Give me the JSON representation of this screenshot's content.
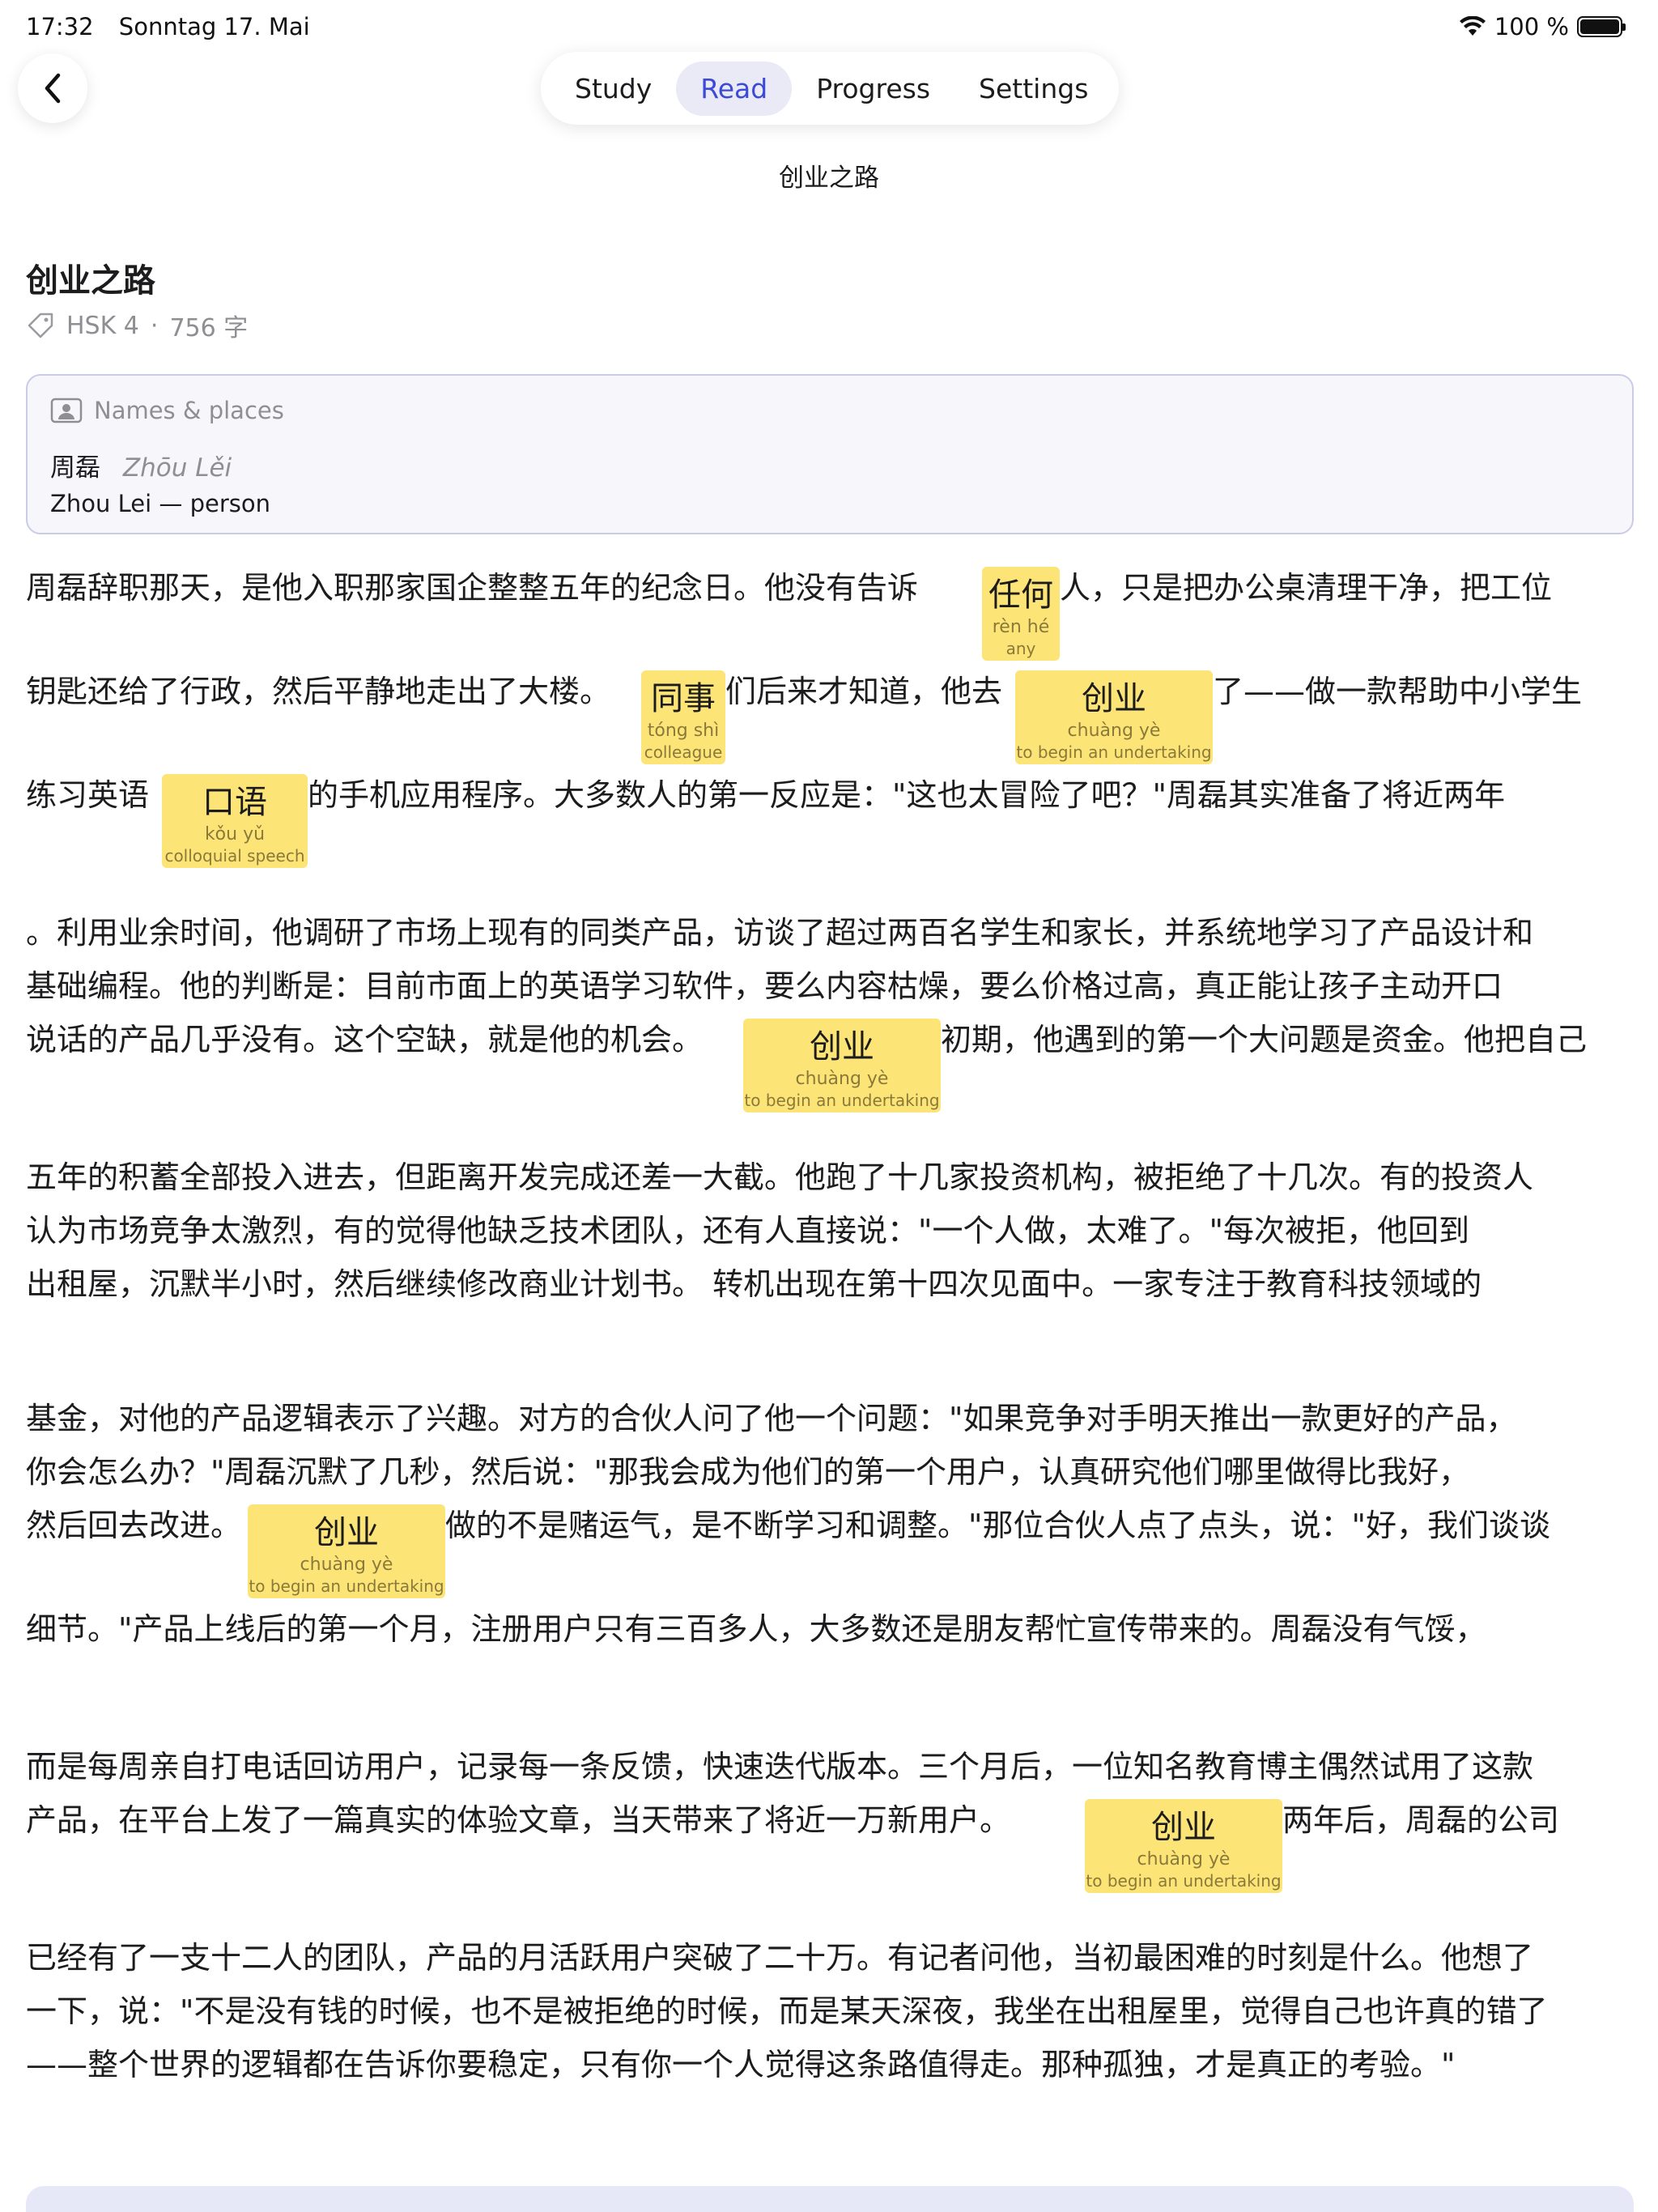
{
  "status": {
    "time": "17:32",
    "date": "Sonntag 17. Mai",
    "battery": "100 %",
    "battery_level": 1.0
  },
  "tabs": [
    {
      "label": "Study"
    },
    {
      "label": "Read",
      "active": true
    },
    {
      "label": "Progress"
    },
    {
      "label": "Settings"
    }
  ],
  "nav_title": "创业之路",
  "doc": {
    "title": "创业之路",
    "level": "HSK 4",
    "separator": "·",
    "count": "756 字"
  },
  "names": {
    "header": "Names & places",
    "items": [
      {
        "hanzi": "周磊",
        "pinyin": "Zhōu Lěi",
        "gloss": "Zhou Lei — person"
      }
    ]
  },
  "lines": [
    "周磊辞职那天，是他入职那家国企整整五年的纪念日。他没有告诉",
    "人，只是把办公桌清理干净，把工位",
    "钥匙还给了行政，然后平静地走出了大楼。",
    "们后来才知道，他去",
    "了——做一款帮助中小学生",
    "练习英语",
    "的手机应用程序。大多数人的第一反应是：\"这也太冒险了吧？\"周磊其实准备了将近两年",
    "。利用业余时间，他调研了市场上现有的同类产品，访谈了超过两百名学生和家长，并系统地学习了产品设计和",
    "基础编程。他的判断是：目前市面上的英语学习软件，要么内容枯燥，要么价格过高，真正能让孩子主动开口",
    "说话的产品几乎没有。这个空缺，就是他的机会。",
    "初期，他遇到的第一个大问题是资金。他把自己",
    "五年的积蓄全部投入进去，但距离开发完成还差一大截。他跑了十几家投资机构，被拒绝了十几次。有的投资人",
    "认为市场竞争太激烈，有的觉得他缺乏技术团队，还有人直接说：\"一个人做，太难了。\"每次被拒，他回到",
    "出租屋，沉默半小时，然后继续修改商业计划书。 转机出现在第十四次见面中。一家专注于教育科技领域的",
    "基金，对他的产品逻辑表示了兴趣。对方的合伙人问了他一个问题：\"如果竞争对手明天推出一款更好的产品，",
    "你会怎么办？\"周磊沉默了几秒，然后说：\"那我会成为他们的第一个用户，认真研究他们哪里做得比我好，",
    "然后回去改进。",
    "做的不是赌运气，是不断学习和调整。\"那位合伙人点了点头，说：\"好，我们谈谈",
    "细节。\"产品上线后的第一个月，注册用户只有三百多人，大多数还是朋友帮忙宣传带来的。周磊没有气馁，",
    "而是每周亲自打电话回访用户，记录每一条反馈，快速迭代版本。三个月后，一位知名教育博主偶然试用了这款",
    "产品，在平台上发了一篇真实的体验文章，当天带来了将近一万新用户。",
    "两年后，周磊的公司",
    "已经有了一支十二人的团队，产品的月活跃用户突破了二十万。有记者问他，当初最困难的时刻是什么。他想了",
    "一下，说：\"不是没有钱的时候，也不是被拒绝的时候，而是某天深夜，我坐在出租屋里，觉得自己也许真的错了",
    "——整个世界的逻辑都在告诉你要稳定，只有你一个人觉得这条路值得走。那种孤独，才是真正的考验。\""
  ],
  "highlights": [
    {
      "word": "任何",
      "pinyin": "rèn hé",
      "gloss": "any"
    },
    {
      "word": "同事",
      "pinyin": "tóng shì",
      "gloss": "colleague"
    },
    {
      "word": "创业",
      "pinyin": "chuàng yè",
      "gloss": "to begin an undertaking"
    },
    {
      "word": "口语",
      "pinyin": "kǒu yǔ",
      "gloss": "colloquial speech"
    },
    {
      "word": "创业",
      "pinyin": "chuàng yè",
      "gloss": "to begin an undertaking"
    },
    {
      "word": "创业",
      "pinyin": "chuàng yè",
      "gloss": "to begin an undertaking"
    },
    {
      "word": "创业",
      "pinyin": "chuàng yè",
      "gloss": "to begin an undertaking"
    }
  ],
  "colors": {
    "accent": "#3c4ad6",
    "highlight": "#fde477",
    "card_bg": "#f6f6fb",
    "card_border": "#c9cbe7"
  }
}
